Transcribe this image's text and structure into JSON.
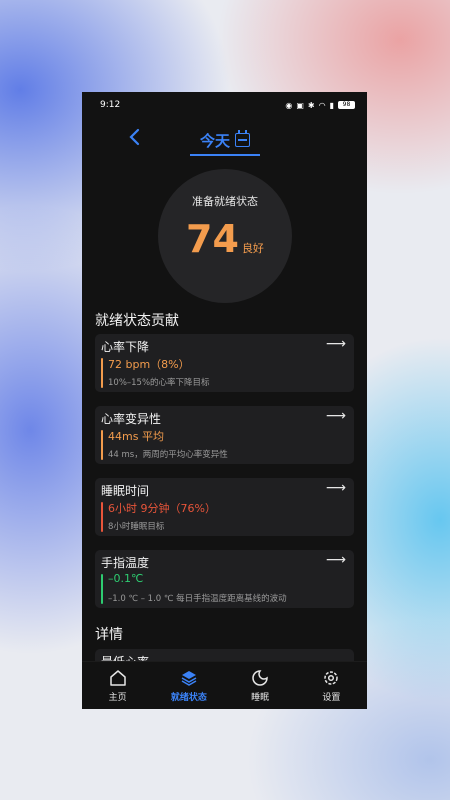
{
  "status_bar": {
    "time": "9:12",
    "battery": "98"
  },
  "header": {
    "title": "今天"
  },
  "readiness": {
    "label": "准备就绪状态",
    "score": "74",
    "status": "良好"
  },
  "contributions": {
    "title": "就绪状态贡献",
    "cards": [
      {
        "title": "心率下降",
        "value": "72 bpm（8%）",
        "desc": "10%–15%的心率下降目标",
        "color": "#f39c4d"
      },
      {
        "title": "心率变异性",
        "value": "44ms 平均",
        "desc": "44 ms，两周的平均心率变异性",
        "color": "#f39c4d"
      },
      {
        "title": "睡眠时间",
        "value": "6小时 9分钟（76%）",
        "desc": "8小时睡眠目标",
        "color": "#e8553a"
      },
      {
        "title": "手指温度",
        "value": "–0.1℃",
        "desc": "–1.0 ℃ – 1.0 ℃ 每日手指温度距离基线的波动",
        "color": "#2ecc71"
      }
    ]
  },
  "details": {
    "title": "详情",
    "first_card_title": "最低心率"
  },
  "nav": {
    "items": [
      {
        "label": "主页",
        "icon": "home-icon"
      },
      {
        "label": "就绪状态",
        "icon": "layers-icon"
      },
      {
        "label": "睡眠",
        "icon": "moon-icon"
      },
      {
        "label": "设置",
        "icon": "gear-icon"
      }
    ]
  },
  "colors": {
    "accent": "#3b82f6",
    "orange": "#f39c4d",
    "red": "#e8553a",
    "green": "#2ecc71"
  }
}
